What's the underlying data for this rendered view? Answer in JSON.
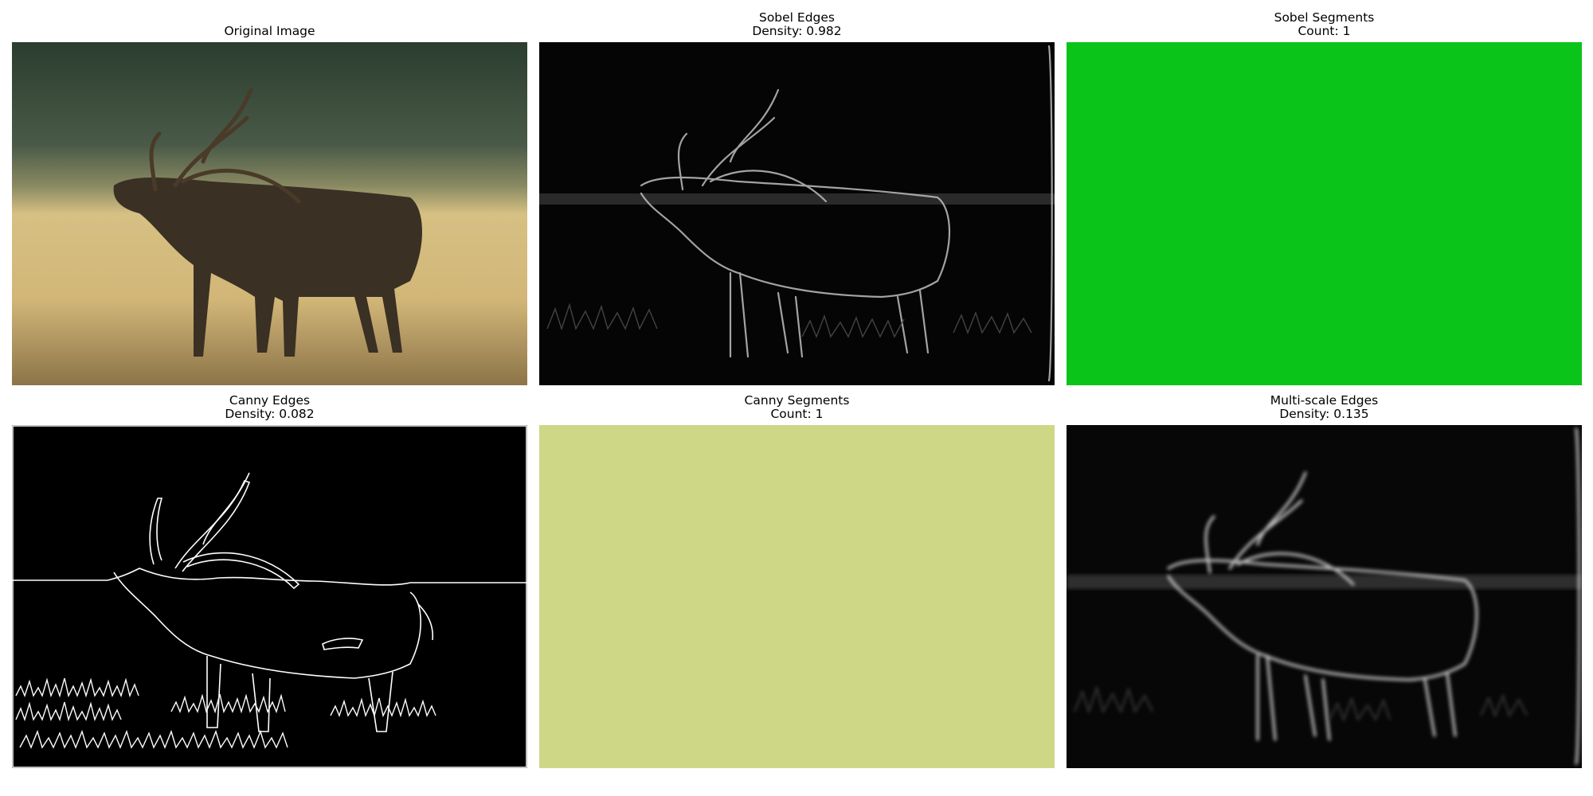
{
  "panels": [
    {
      "title": "Original Image"
    },
    {
      "title": "Sobel Edges",
      "subtitle": "Density: 0.982"
    },
    {
      "title": "Sobel Segments",
      "subtitle": "Count: 1",
      "fill_color": "#0bc41a"
    },
    {
      "title": "Canny Edges",
      "subtitle": "Density: 0.082"
    },
    {
      "title": "Canny Segments",
      "subtitle": "Count: 1",
      "fill_color": "#ced786"
    },
    {
      "title": "Multi-scale Edges",
      "subtitle": "Density: 0.135"
    }
  ]
}
